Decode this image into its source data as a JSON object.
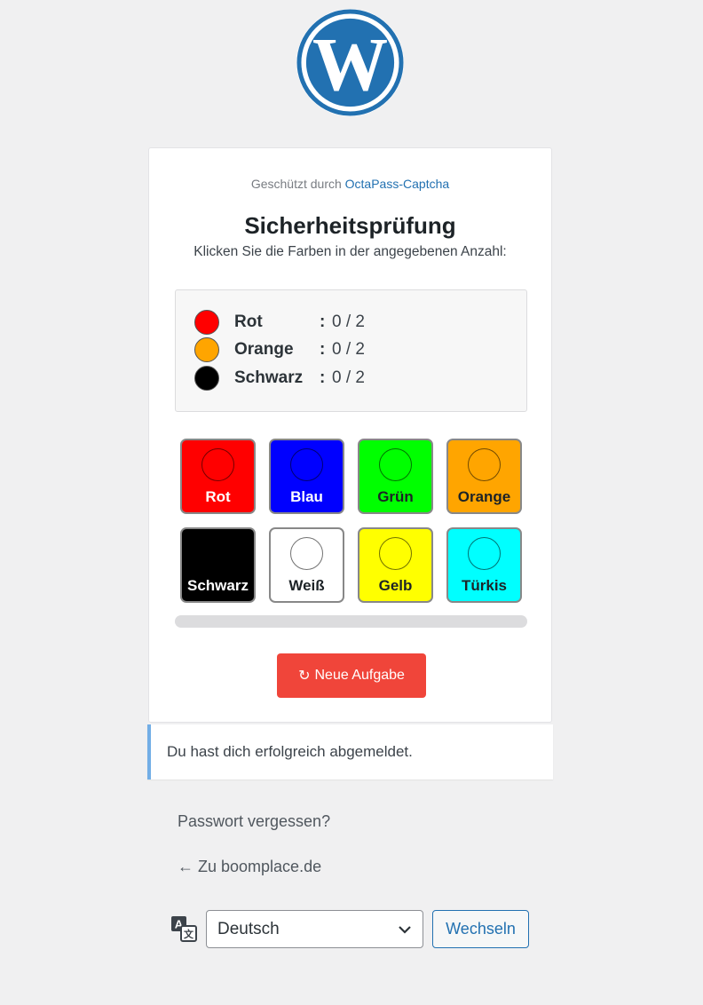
{
  "logo": {
    "icon": "wordpress-logo-icon",
    "color": "#2271b1"
  },
  "captcha": {
    "protected_prefix": "Geschützt durch",
    "protected_link": "OctaPass-Captcha",
    "title": "Sicherheitsprüfung",
    "subtitle": "Klicken Sie die Farben in der angegebenen Anzahl:",
    "requirements": [
      {
        "name": "Rot",
        "colon": ":",
        "count": "0 / 2",
        "color": "#ff0000"
      },
      {
        "name": "Orange",
        "colon": ":",
        "count": "0 / 2",
        "color": "#ffa500"
      },
      {
        "name": "Schwarz",
        "colon": ":",
        "count": "0 / 2",
        "color": "#000000"
      }
    ],
    "tiles": [
      {
        "label": "Rot",
        "color": "#ff0000",
        "text_color": "#ffffff"
      },
      {
        "label": "Blau",
        "color": "#0000ff",
        "text_color": "#ffffff"
      },
      {
        "label": "Grün",
        "color": "#00ff00",
        "text_color": "#1d2327"
      },
      {
        "label": "Orange",
        "color": "#ffa500",
        "text_color": "#1d2327"
      },
      {
        "label": "Schwarz",
        "color": "#000000",
        "text_color": "#ffffff"
      },
      {
        "label": "Weiß",
        "color": "#ffffff",
        "text_color": "#1d2327"
      },
      {
        "label": "Gelb",
        "color": "#ffff00",
        "text_color": "#1d2327"
      },
      {
        "label": "Türkis",
        "color": "#00ffff",
        "text_color": "#1d2327"
      }
    ],
    "progress": 0,
    "new_task_icon": "↻",
    "new_task_label": "Neue Aufgabe"
  },
  "notice": {
    "text": "Du hast dich erfolgreich abgemeldet.",
    "accent": "#72aee6"
  },
  "links": {
    "lost_password": "Passwort vergessen?",
    "back_to_site": "← Zu boomplace.de"
  },
  "language": {
    "icon": "translate-icon",
    "selected": "Deutsch",
    "switch_label": "Wechseln"
  }
}
